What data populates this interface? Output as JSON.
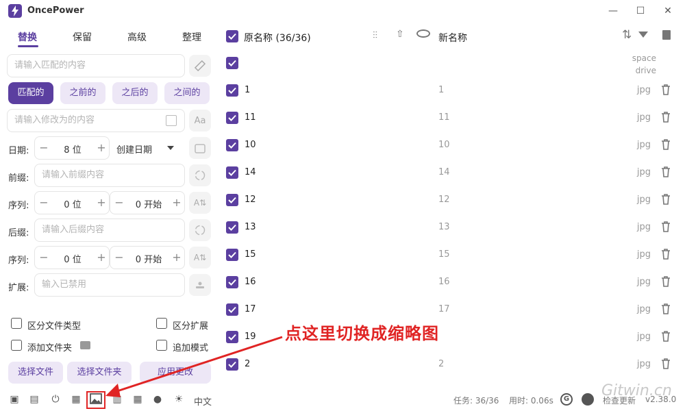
{
  "app": {
    "title": "OncePower"
  },
  "window": {
    "minimize": "—",
    "maximize": "☐",
    "close": "✕"
  },
  "tabs": [
    {
      "label": "替换"
    },
    {
      "label": "保留"
    },
    {
      "label": "高级"
    },
    {
      "label": "整理"
    }
  ],
  "replace": {
    "match_placeholder": "请输入匹配的内容",
    "modes": [
      {
        "label": "匹配的"
      },
      {
        "label": "之前的"
      },
      {
        "label": "之后的"
      },
      {
        "label": "之间的"
      }
    ],
    "modify_placeholder": "请输入修改为的内容"
  },
  "date": {
    "label": "日期:",
    "digits": "8 位",
    "type": "创建日期"
  },
  "prefix": {
    "label": "前缀:",
    "placeholder": "请输入前缀内容"
  },
  "seq1": {
    "label": "序列:",
    "digits": "0 位",
    "start": "0 开始"
  },
  "suffix": {
    "label": "后缀:",
    "placeholder": "请输入后缀内容"
  },
  "seq2": {
    "label": "序列:",
    "digits": "0 位",
    "start": "0 开始"
  },
  "ext": {
    "label": "扩展:",
    "placeholder": "输入已禁用"
  },
  "options": {
    "distinguish_type": "区分文件类型",
    "distinguish_ext": "区分扩展",
    "add_folder": "添加文件夹",
    "append_mode": "追加模式"
  },
  "buttons": {
    "select_file": "选择文件",
    "select_folder": "选择文件夹",
    "apply": "应用更改"
  },
  "table": {
    "original_header": "原名称 (36/36)",
    "new_header": "新名称",
    "first_row_ext_line1": "space",
    "first_row_ext_line2": "drive",
    "rows": [
      {
        "name": "1",
        "new": "1",
        "ext": "jpg"
      },
      {
        "name": "11",
        "new": "11",
        "ext": "jpg"
      },
      {
        "name": "10",
        "new": "10",
        "ext": "jpg"
      },
      {
        "name": "14",
        "new": "14",
        "ext": "jpg"
      },
      {
        "name": "12",
        "new": "12",
        "ext": "jpg"
      },
      {
        "name": "13",
        "new": "13",
        "ext": "jpg"
      },
      {
        "name": "15",
        "new": "15",
        "ext": "jpg"
      },
      {
        "name": "16",
        "new": "16",
        "ext": "jpg"
      },
      {
        "name": "17",
        "new": "17",
        "ext": "jpg"
      },
      {
        "name": "19",
        "new": "",
        "ext": "jpg"
      },
      {
        "name": "2",
        "new": "2",
        "ext": "jpg"
      }
    ]
  },
  "footer": {
    "language": "中文",
    "task": "任务: 36/36",
    "time": "用时: 0.06s",
    "update": "检查更新",
    "version": "v2.38.0"
  },
  "annotation": "点这里切换成缩略图",
  "watermark": "Gitwin.cn",
  "colors": {
    "accent": "#5b3fa0",
    "annotation": "#e02424"
  }
}
